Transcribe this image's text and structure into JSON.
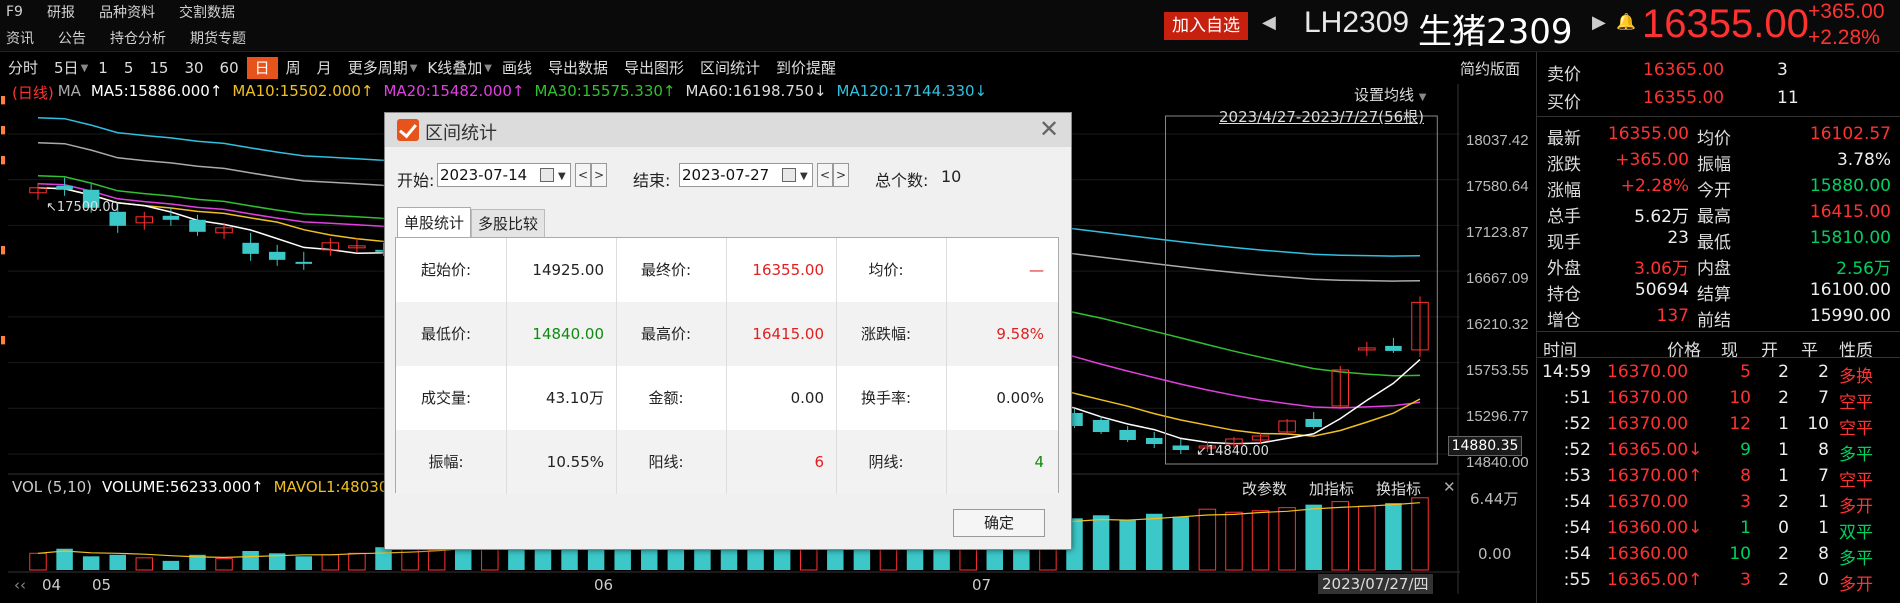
{
  "menu": {
    "row1": [
      "F9",
      "研报",
      "品种资料",
      "交割数据"
    ],
    "row2": [
      "资讯",
      "公告",
      "持仓分析",
      "期货专题"
    ]
  },
  "header": {
    "add_fav": "加入自选",
    "code": "LH2309",
    "name": "生猪2309",
    "price": "16355.00",
    "change": "+365.00",
    "change_pct": "+2.28%"
  },
  "toolbar": {
    "items": [
      "分时",
      "5日",
      "1",
      "5",
      "15",
      "30",
      "60",
      "日",
      "周",
      "月",
      "更多周期",
      "K线叠加",
      "画线",
      "导出数据",
      "导出图形",
      "区间统计",
      "到价提醒"
    ],
    "active": "日",
    "simple": "简约版面"
  },
  "ma": {
    "prefix": "(日线)",
    "ma_label": "MA",
    "ma5": "MA5:15886.000↑",
    "ma10": "MA10:15502.000↑",
    "ma20": "MA20:15482.000↑",
    "ma30": "MA30:15575.330↑",
    "ma60": "MA60:16198.750↓",
    "ma120": "MA120:17144.330↓",
    "set_ma": "设置均线",
    "range": "2023/4/27-2023/7/27(56根)"
  },
  "colors": {
    "up": "#ff3232",
    "down": "#3cc8c8",
    "ma5": "#ffffff",
    "ma10": "#f0c020",
    "ma20": "#e040e0",
    "ma30": "#30c030",
    "ma60": "#aaaaaa",
    "ma120": "#30c0e0"
  },
  "axis": {
    "prices": [
      "18037.42",
      "17580.64",
      "17123.87",
      "16667.09",
      "16210.32",
      "15753.55",
      "15296.77",
      "14840.00"
    ],
    "current": "14880.35",
    "high_mark": "17500.00",
    "low_mark": "14840.00"
  },
  "volume": {
    "label": "VOL (5,10)",
    "value": "VOLUME:56233.000↑",
    "mavol": "MAVOL1:48030.0",
    "tools": [
      "改参数",
      "加指标",
      "换指标"
    ],
    "top": "6.44万",
    "zero": "0.00"
  },
  "dates": {
    "d04": "04",
    "d05": "05",
    "d06": "06",
    "d07": "07",
    "badge": "2023/07/27/四"
  },
  "quote": {
    "ask_label": "卖价",
    "ask_price": "16365.00",
    "ask_vol": "3",
    "bid_label": "买价",
    "bid_price": "16355.00",
    "bid_vol": "11",
    "rows": [
      {
        "l1": "最新",
        "v1": "16355.00",
        "c1": "red",
        "l2": "均价",
        "v2": "16102.57",
        "c2": "red"
      },
      {
        "l1": "涨跌",
        "v1": "+365.00",
        "c1": "red",
        "l2": "振幅",
        "v2": "3.78%",
        "c2": "white"
      },
      {
        "l1": "涨幅",
        "v1": "+2.28%",
        "c1": "red",
        "l2": "今开",
        "v2": "15880.00",
        "c2": "green"
      },
      {
        "l1": "总手",
        "v1": "5.62万",
        "c1": "white",
        "l2": "最高",
        "v2": "16415.00",
        "c2": "red"
      },
      {
        "l1": "现手",
        "v1": "23",
        "c1": "white",
        "l2": "最低",
        "v2": "15810.00",
        "c2": "green"
      },
      {
        "l1": "外盘",
        "v1": "3.06万",
        "c1": "red",
        "l2": "内盘",
        "v2": "2.56万",
        "c2": "green"
      },
      {
        "l1": "持仓",
        "v1": "50694",
        "c1": "white",
        "l2": "结算",
        "v2": "16100.00",
        "c2": "white"
      },
      {
        "l1": "增仓",
        "v1": "137",
        "c1": "red",
        "l2": "前结",
        "v2": "15990.00",
        "c2": "white"
      }
    ]
  },
  "ticks": {
    "headers": [
      "时间",
      "价格",
      "现",
      "开",
      "平",
      "性质"
    ],
    "rows": [
      {
        "t": "14:59",
        "p": "16370.00",
        "pc": "red",
        "n": "5",
        "nc": "red",
        "o": "2",
        "c": "2",
        "k": "多换",
        "kc": "red"
      },
      {
        "t": ":51",
        "p": "16370.00",
        "pc": "red",
        "n": "10",
        "nc": "red",
        "o": "2",
        "c": "7",
        "k": "空平",
        "kc": "red"
      },
      {
        "t": ":52",
        "p": "16370.00",
        "pc": "red",
        "n": "12",
        "nc": "red",
        "o": "1",
        "c": "10",
        "k": "空平",
        "kc": "red"
      },
      {
        "t": ":52",
        "p": "16365.00↓",
        "pc": "red",
        "n": "9",
        "nc": "green",
        "o": "1",
        "c": "8",
        "k": "多平",
        "kc": "green"
      },
      {
        "t": ":53",
        "p": "16370.00↑",
        "pc": "red",
        "n": "8",
        "nc": "red",
        "o": "1",
        "c": "7",
        "k": "空平",
        "kc": "red"
      },
      {
        "t": ":54",
        "p": "16370.00",
        "pc": "red",
        "n": "3",
        "nc": "red",
        "o": "2",
        "c": "1",
        "k": "多开",
        "kc": "red"
      },
      {
        "t": ":54",
        "p": "16360.00↓",
        "pc": "red",
        "n": "1",
        "nc": "green",
        "o": "0",
        "c": "1",
        "k": "双平",
        "kc": "green"
      },
      {
        "t": ":54",
        "p": "16360.00",
        "pc": "red",
        "n": "10",
        "nc": "green",
        "o": "2",
        "c": "8",
        "k": "多平",
        "kc": "green"
      },
      {
        "t": ":55",
        "p": "16365.00↑",
        "pc": "red",
        "n": "3",
        "nc": "red",
        "o": "2",
        "c": "0",
        "k": "多开",
        "kc": "red"
      }
    ]
  },
  "dialog": {
    "title": "区间统计",
    "start_label": "开始:",
    "start_value": "2023-07-14",
    "end_label": "结束:",
    "end_value": "2023-07-27",
    "total_label": "总个数:",
    "total_value": "10",
    "tab_single": "单股统计",
    "tab_multi": "多股比较",
    "ok": "确定",
    "stats": [
      [
        {
          "l": "起始价:",
          "v": "14925.00",
          "c": "#222"
        },
        {
          "l": "最终价:",
          "v": "16355.00",
          "c": "#e02020"
        },
        {
          "l": "均价:",
          "v": "—",
          "c": "#e02020"
        }
      ],
      [
        {
          "l": "最低价:",
          "v": "14840.00",
          "c": "#108a10"
        },
        {
          "l": "最高价:",
          "v": "16415.00",
          "c": "#e02020"
        },
        {
          "l": "涨跌幅:",
          "v": "9.58%",
          "c": "#e02020"
        }
      ],
      [
        {
          "l": "成交量:",
          "v": "43.10万",
          "c": "#222"
        },
        {
          "l": "金额:",
          "v": "0.00",
          "c": "#222"
        },
        {
          "l": "换手率:",
          "v": "0.00%",
          "c": "#222"
        }
      ],
      [
        {
          "l": "振幅:",
          "v": "10.55%",
          "c": "#222"
        },
        {
          "l": "阳线:",
          "v": "6",
          "c": "#e02020"
        },
        {
          "l": "阴线:",
          "v": "4",
          "c": "#108a10"
        }
      ]
    ]
  },
  "chart_data": {
    "type": "candlestick",
    "y_range": [
      14840.0,
      18037.42
    ],
    "candles": [
      [
        17450,
        17550,
        17380,
        17500
      ],
      [
        17520,
        17600,
        17420,
        17480
      ],
      [
        17480,
        17540,
        17250,
        17300
      ],
      [
        17260,
        17350,
        17050,
        17120
      ],
      [
        17150,
        17260,
        17080,
        17210
      ],
      [
        17220,
        17300,
        17120,
        17180
      ],
      [
        17180,
        17230,
        17020,
        17060
      ],
      [
        17050,
        17150,
        16990,
        17100
      ],
      [
        16950,
        17050,
        16770,
        16840
      ],
      [
        16860,
        16930,
        16720,
        16780
      ],
      [
        16760,
        16860,
        16680,
        16740
      ],
      [
        16880,
        17000,
        16820,
        16950
      ],
      [
        16900,
        17000,
        16850,
        16920
      ],
      [
        16880,
        16950,
        16820,
        16860
      ],
      [
        16900,
        16960,
        16860,
        16940
      ],
      [
        16920,
        17000,
        16880,
        16940
      ],
      [
        16880,
        16950,
        16800,
        16840
      ],
      [
        16820,
        16930,
        16790,
        16900
      ],
      [
        16880,
        16920,
        16760,
        16790
      ],
      [
        16770,
        16840,
        16620,
        16680
      ],
      [
        16600,
        16720,
        16500,
        16540
      ],
      [
        16480,
        16560,
        16350,
        16380
      ],
      [
        16350,
        16420,
        16200,
        16250
      ],
      [
        16230,
        16300,
        16120,
        16180
      ],
      [
        16150,
        16220,
        16050,
        16100
      ],
      [
        16080,
        16150,
        15980,
        16040
      ],
      [
        16000,
        16060,
        15920,
        15960
      ],
      [
        15940,
        16000,
        15840,
        15880
      ],
      [
        15850,
        15930,
        15780,
        15800
      ],
      [
        15800,
        15880,
        15740,
        15860
      ],
      [
        15760,
        15840,
        15680,
        15700
      ],
      [
        15700,
        15760,
        15600,
        15620
      ],
      [
        15640,
        15720,
        15560,
        15680
      ],
      [
        15600,
        15660,
        15500,
        15520
      ],
      [
        15520,
        15580,
        15420,
        15440
      ],
      [
        15460,
        15540,
        15380,
        15500
      ],
      [
        15420,
        15480,
        15320,
        15340
      ],
      [
        15320,
        15380,
        15200,
        15220
      ],
      [
        15300,
        15360,
        15180,
        15320
      ],
      [
        15250,
        15290,
        15100,
        15120
      ],
      [
        15180,
        15220,
        15040,
        15060
      ],
      [
        15080,
        15120,
        14960,
        14980
      ],
      [
        15000,
        15060,
        14900,
        14940
      ],
      [
        14925,
        14990,
        14840,
        14880
      ],
      [
        14900,
        14960,
        14860,
        14920
      ],
      [
        14940,
        15010,
        14900,
        14990
      ],
      [
        14980,
        15050,
        14940,
        15020
      ],
      [
        15060,
        15190,
        15040,
        15170
      ],
      [
        15190,
        15260,
        15090,
        15110
      ],
      [
        15320,
        15720,
        15300,
        15680
      ],
      [
        15880,
        15960,
        15820,
        15900
      ],
      [
        15920,
        16000,
        15850,
        15870
      ],
      [
        15880,
        16415,
        15810,
        16355
      ]
    ],
    "volumes": [
      0.22,
      0.28,
      0.18,
      0.2,
      0.16,
      0.12,
      0.2,
      0.15,
      0.25,
      0.22,
      0.18,
      0.2,
      0.22,
      0.3,
      0.28,
      0.26,
      0.34,
      0.3,
      0.38,
      0.4,
      0.36,
      0.42,
      0.38,
      0.45,
      0.5,
      0.44,
      0.48,
      0.55,
      0.5,
      0.6,
      0.52,
      0.58,
      0.62,
      0.56,
      0.66,
      0.6,
      0.7,
      0.64,
      0.58,
      0.68,
      0.72,
      0.66,
      0.74,
      0.7,
      0.8,
      0.76,
      0.78,
      0.82,
      0.86,
      0.9,
      0.84,
      0.88,
      0.95
    ]
  }
}
